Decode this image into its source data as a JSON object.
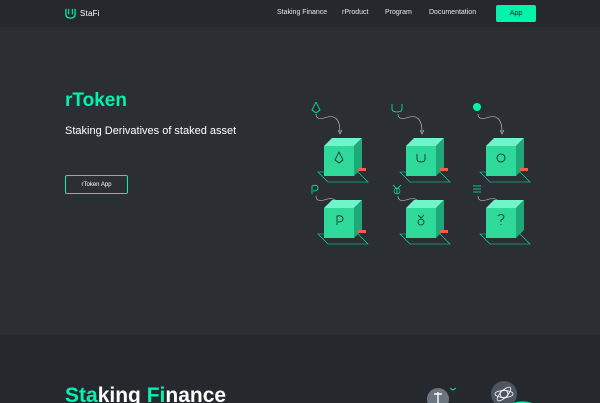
{
  "brand": {
    "name": "StaFi",
    "accent": "#00f3ab",
    "background": "#2b2f34",
    "navbar_bg": "#25292d"
  },
  "nav": {
    "links": [
      {
        "label": "Staking Finance"
      },
      {
        "label": "rProduct"
      },
      {
        "label": "Program"
      },
      {
        "label": "Documentation"
      }
    ],
    "app_button": "App"
  },
  "hero": {
    "title": "rToken",
    "subtitle": "Staking Derivatives of staked asset",
    "button": "rToken App"
  },
  "illustration": {
    "tokens": [
      {
        "icon": "ethereum-icon"
      },
      {
        "icon": "stafi-icon"
      },
      {
        "icon": "cosmos-icon"
      },
      {
        "icon": "polkadot-icon"
      },
      {
        "icon": "kusama-icon"
      },
      {
        "icon": "unknown-token-icon"
      }
    ]
  },
  "section2": {
    "title_parts": [
      {
        "text": "Sta",
        "highlight": true
      },
      {
        "text": "king ",
        "highlight": false
      },
      {
        "text": "Fi",
        "highlight": true
      },
      {
        "text": "nance",
        "highlight": false
      }
    ],
    "icons": [
      "tezos-icon",
      "cosmos-icon"
    ]
  }
}
